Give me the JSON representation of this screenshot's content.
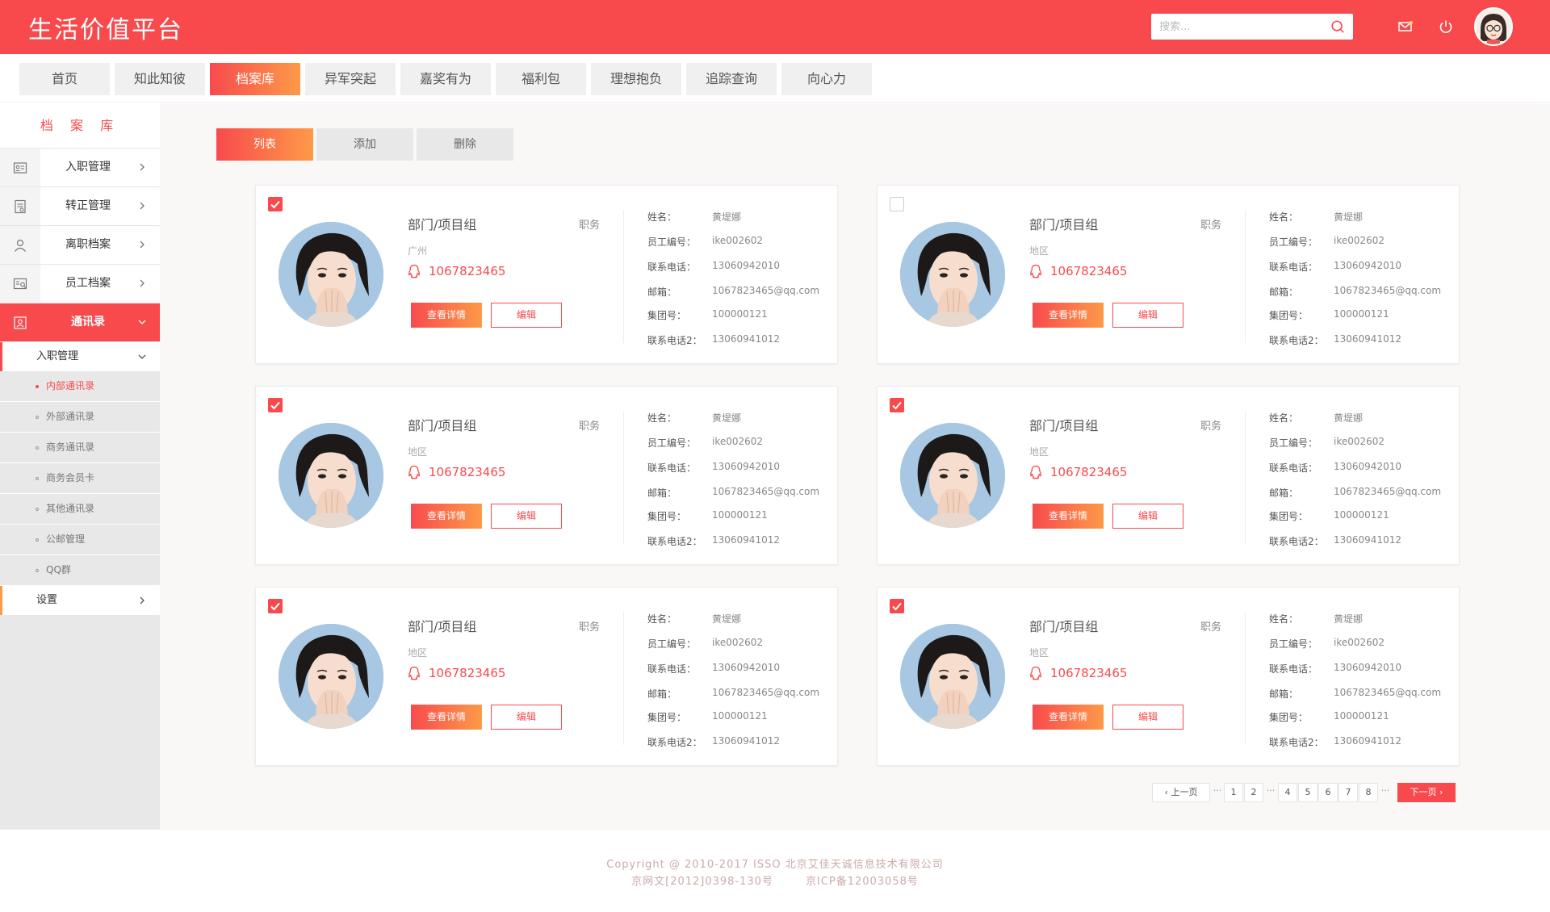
{
  "header": {
    "title": "生活价值平台",
    "search_placeholder": "搜索...",
    "icons": [
      "search-icon",
      "mail-icon",
      "power-icon"
    ]
  },
  "nav": {
    "tabs": [
      "首页",
      "知此知彼",
      "档案库",
      "异军突起",
      "嘉奖有为",
      "福利包",
      "理想抱负",
      "追踪查询",
      "向心力"
    ],
    "active_index": 2
  },
  "sidebar": {
    "title": "档 案 库",
    "items": [
      {
        "label": "入职管理",
        "icon": "id-card-icon"
      },
      {
        "label": "转正管理",
        "icon": "document-icon"
      },
      {
        "label": "离职档案",
        "icon": "user-icon"
      },
      {
        "label": "员工档案",
        "icon": "profile-icon"
      },
      {
        "label": "通讯录",
        "icon": "contacts-icon"
      }
    ],
    "sub_header": "入职管理",
    "sub_items": [
      "内部通讯录",
      "外部通讯录",
      "商务通讯录",
      "商务会员卡",
      "其他通讯录",
      "公邮管理",
      "QQ群"
    ],
    "active_sub_index": 0,
    "settings": "设置"
  },
  "toolbar": {
    "list": "列表",
    "add": "添加",
    "delete": "删除"
  },
  "labels": {
    "name": "姓名：",
    "employee_id": "员工编号：",
    "phone": "联系电话：",
    "email": "邮箱：",
    "group_no": "集团号：",
    "phone2": "联系电话2：",
    "view_detail": "查看详情",
    "edit": "编辑"
  },
  "cards": [
    {
      "checked": true,
      "dept": "部门/项目组",
      "role": "职务",
      "location": "广州",
      "qq": "1067823465",
      "name": "黄堤娜",
      "employee_id": "ike002602",
      "phone": "13060942010",
      "email": "1067823465@qq.com",
      "group_no": "100000121",
      "phone2": "13060941012"
    },
    {
      "checked": false,
      "dept": "部门/项目组",
      "role": "职务",
      "location": "地区",
      "qq": "1067823465",
      "name": "黄堤娜",
      "employee_id": "ike002602",
      "phone": "13060942010",
      "email": "1067823465@qq.com",
      "group_no": "100000121",
      "phone2": "13060941012"
    },
    {
      "checked": true,
      "dept": "部门/项目组",
      "role": "职务",
      "location": "地区",
      "qq": "1067823465",
      "name": "黄堤娜",
      "employee_id": "ike002602",
      "phone": "13060942010",
      "email": "1067823465@qq.com",
      "group_no": "100000121",
      "phone2": "13060941012"
    },
    {
      "checked": true,
      "dept": "部门/项目组",
      "role": "职务",
      "location": "地区",
      "qq": "1067823465",
      "name": "黄堤娜",
      "employee_id": "ike002602",
      "phone": "13060942010",
      "email": "1067823465@qq.com",
      "group_no": "100000121",
      "phone2": "13060941012"
    },
    {
      "checked": true,
      "dept": "部门/项目组",
      "role": "职务",
      "location": "地区",
      "qq": "1067823465",
      "name": "黄堤娜",
      "employee_id": "ike002602",
      "phone": "13060942010",
      "email": "1067823465@qq.com",
      "group_no": "100000121",
      "phone2": "13060941012"
    },
    {
      "checked": true,
      "dept": "部门/项目组",
      "role": "职务",
      "location": "地区",
      "qq": "1067823465",
      "name": "黄堤娜",
      "employee_id": "ike002602",
      "phone": "13060942010",
      "email": "1067823465@qq.com",
      "group_no": "100000121",
      "phone2": "13060941012"
    }
  ],
  "pagination": {
    "prev": "上一页",
    "next": "下一页",
    "ellipsis": "···",
    "pages": [
      "1",
      "2",
      "4",
      "5",
      "6",
      "7",
      "8"
    ]
  },
  "footer": {
    "copyright": "Copyright @ 2010-2017 ISSO 北京艾佳天诚信息技术有限公司",
    "license1": "京网文[2012]0398-130号",
    "license2": "京ICP备12003058号"
  },
  "colors": {
    "primary": "#f84a4d",
    "accent": "#fd9a48"
  }
}
